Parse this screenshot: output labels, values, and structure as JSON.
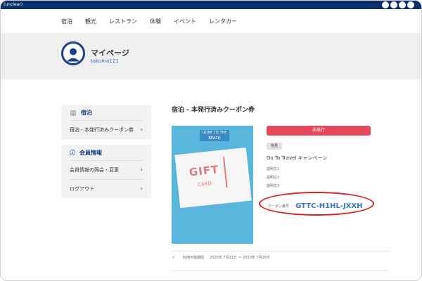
{
  "topbar": {
    "site_title": "(unclear)"
  },
  "nav": {
    "items": [
      "宿泊",
      "観光",
      "レストラン",
      "体験",
      "イベント",
      "レンタカー"
    ]
  },
  "profile": {
    "title": "マイページ",
    "username": "takuma121"
  },
  "sidebar": {
    "sections": [
      {
        "heading": "宿泊",
        "icon": "building-icon",
        "items": [
          "宿泊・本発行済みクーポン券"
        ]
      },
      {
        "heading": "会員情報",
        "icon": "member-icon",
        "items": [
          "会員情報の照会・変更",
          "ログアウト"
        ]
      }
    ]
  },
  "main": {
    "title": "宿泊 - 本発行済みクーポン券",
    "status_badge": "未発行",
    "tag": "発見",
    "campaign": "Go To Travel キャンペーン",
    "descriptions": [
      "説明文1",
      "説明文2",
      "説明文3"
    ],
    "coupon_code_label": "クーポン番号",
    "coupon_code": "GTTC-H1HL-JXXH",
    "period_label": "利用可能期間",
    "period_value": "2020年 7月21日 ～ 2020年 7月26日"
  },
  "image": {
    "gift_text": "GIFT",
    "card_text": "CARD",
    "beach_text": "GONE TO THE BEACH"
  },
  "colors": {
    "header": "#0b2f6d",
    "accent": "#1b3f8b",
    "badge": "#e6475a",
    "highlight": "#d81f1f",
    "code": "#3b77c9"
  }
}
